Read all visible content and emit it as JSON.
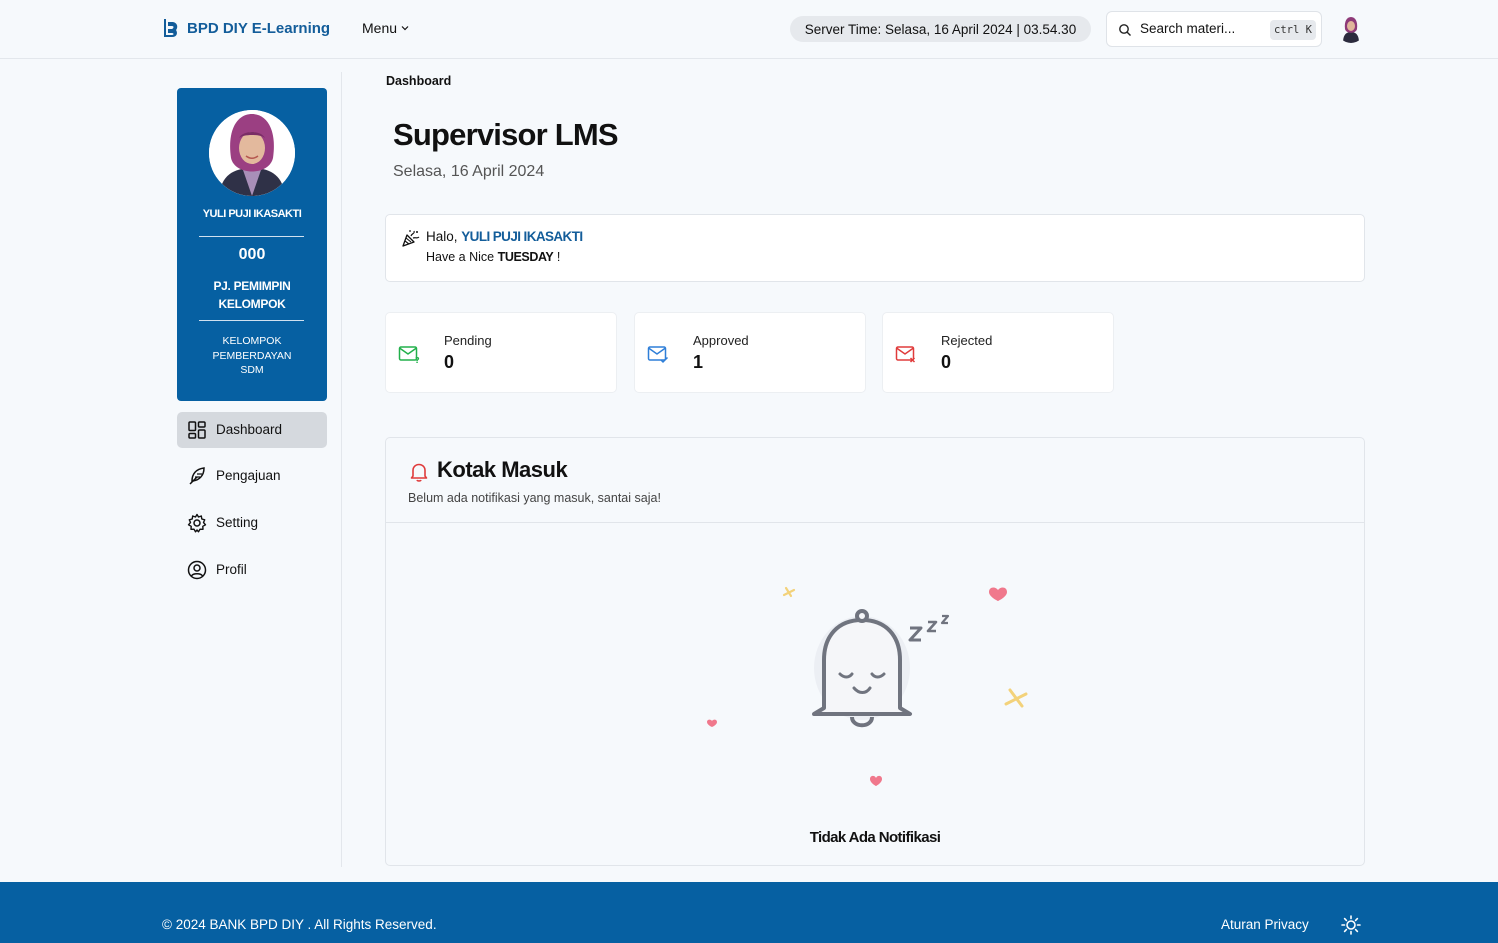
{
  "header": {
    "brand": "BPD DIY E-Learning",
    "menu_label": "Menu",
    "server_time": "Server Time: Selasa, 16 April 2024 | 03.54.30",
    "search_placeholder": "Search materi...",
    "search_shortcut": "ctrl K"
  },
  "profile": {
    "name": "YULI PUJI IKASAKTI",
    "code": "000",
    "title": "PJ. PEMIMPIN KELOMPOK",
    "unit": "KELOMPOK PEMBERDAYAN SDM"
  },
  "sidebar": {
    "items": [
      {
        "label": "Dashboard",
        "icon": "dashboard-grid-icon",
        "active": true
      },
      {
        "label": "Pengajuan",
        "icon": "feather-pen-icon",
        "active": false
      },
      {
        "label": "Setting",
        "icon": "gear-icon",
        "active": false
      },
      {
        "label": "Profil",
        "icon": "user-circle-icon",
        "active": false
      }
    ]
  },
  "main": {
    "breadcrumb": "Dashboard",
    "title": "Supervisor LMS",
    "date": "Selasa, 16 April 2024",
    "greeting": {
      "hello": "Halo,",
      "name": "YULI PUJI IKASAKTI",
      "line_prefix": "Have a Nice",
      "day": "TUESDAY",
      "line_suffix": "!"
    },
    "stats": [
      {
        "label": "Pending",
        "value": "0",
        "color": "#22b04b"
      },
      {
        "label": "Approved",
        "value": "1",
        "color": "#2f7fd8"
      },
      {
        "label": "Rejected",
        "value": "0",
        "color": "#e03b3b"
      }
    ],
    "inbox": {
      "title": "Kotak Masuk",
      "subtitle": "Belum ada notifikasi yang masuk, santai saja!",
      "empty_text": "Tidak Ada Notifikasi"
    }
  },
  "footer": {
    "copyright": "© 2024 BANK BPD DIY . All Rights Reserved.",
    "privacy": "Aturan Privacy"
  },
  "colors": {
    "primary": "#0660a2",
    "brand_text": "#135d9a",
    "background": "#f6f9fc"
  }
}
